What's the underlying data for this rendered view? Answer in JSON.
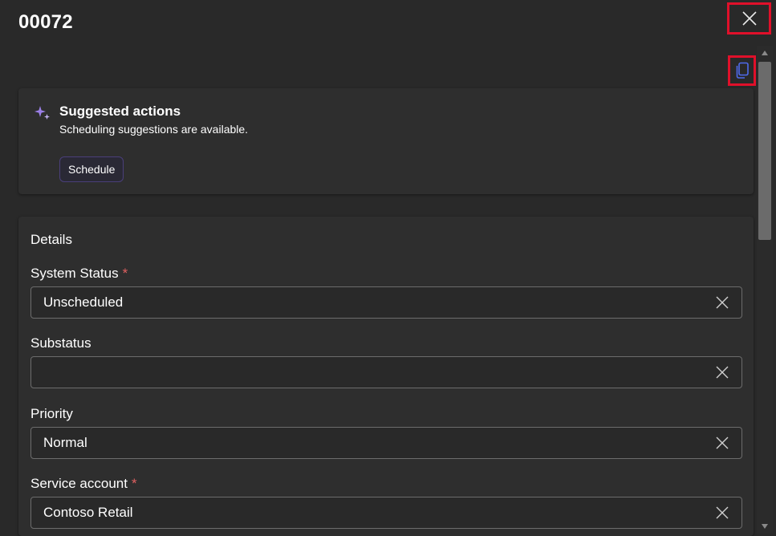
{
  "header": {
    "title": "00072"
  },
  "suggested_actions": {
    "title": "Suggested actions",
    "subtitle": "Scheduling suggestions are available.",
    "button_label": "Schedule"
  },
  "details": {
    "section_title": "Details",
    "fields": [
      {
        "label": "System Status",
        "required": "*",
        "value": "Unscheduled"
      },
      {
        "label": "Substatus",
        "required": "",
        "value": ""
      },
      {
        "label": "Priority",
        "required": "",
        "value": "Normal"
      },
      {
        "label": "Service account",
        "required": "*",
        "value": "Contoso Retail"
      }
    ]
  },
  "colors": {
    "background": "#292929",
    "highlight_box": "#e0102a",
    "required_star": "#e06060",
    "sparkle": "#9b7fe8",
    "copy_icon": "#4f6bed"
  },
  "icons": [
    "close-icon",
    "copy-icon",
    "sparkle-icon",
    "clear-icon"
  ]
}
